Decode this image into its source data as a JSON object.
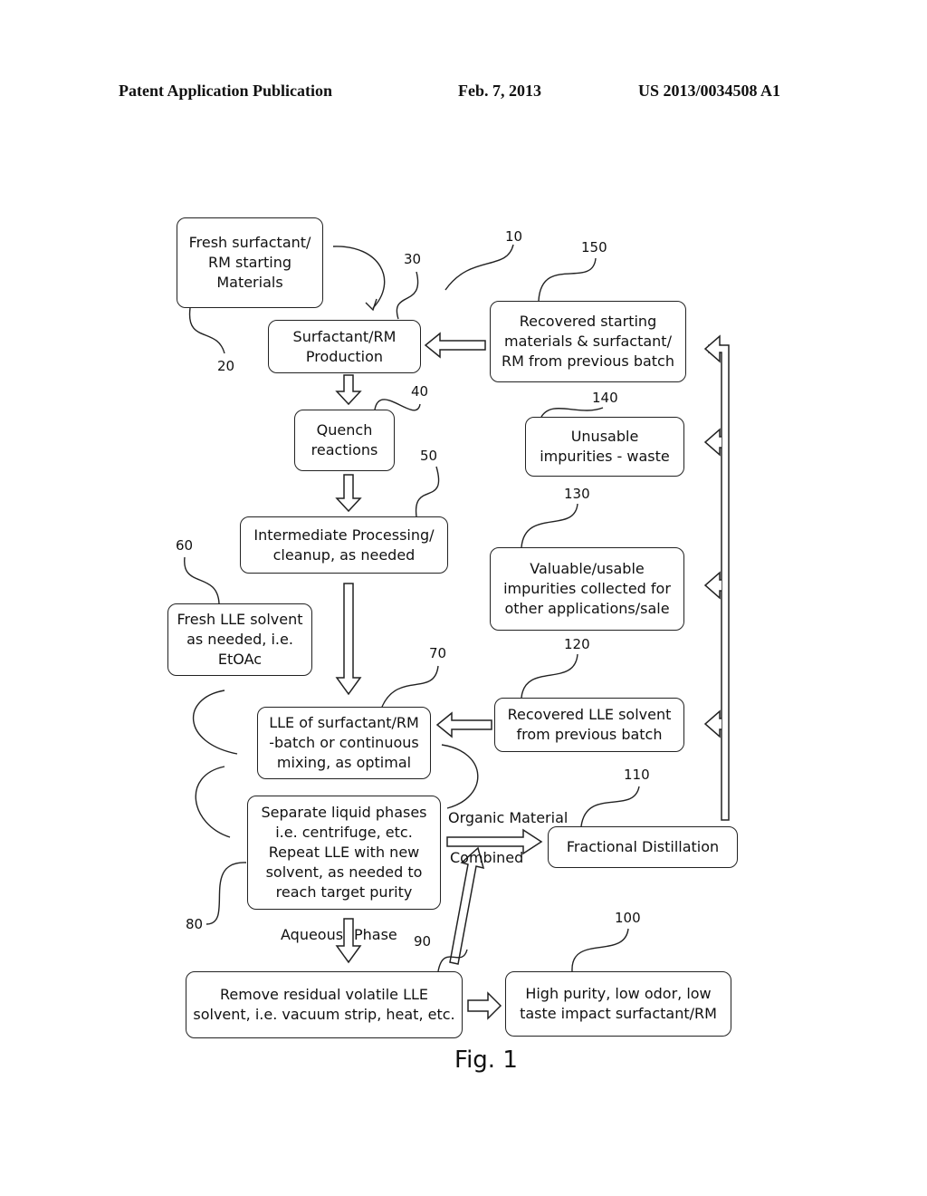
{
  "header": {
    "left": "Patent Application Publication",
    "center": "Feb. 7, 2013",
    "right": "US 2013/0034508 A1"
  },
  "boxes": {
    "fresh_surfactant": "Fresh surfactant/\nRM starting\nMaterials",
    "production": "Surfactant/RM\nProduction",
    "quench": "Quench\nreactions",
    "intermediate": "Intermediate Processing/\ncleanup, as needed",
    "fresh_lle": "Fresh LLE solvent\nas needed, i.e.\nEtOAc",
    "lle": "LLE of surfactant/RM\n-batch or continuous\nmixing, as optimal",
    "separate": "Separate liquid phases\ni.e. centrifuge, etc.\nRepeat LLE with new\nsolvent, as needed to\nreach target purity",
    "remove_residual": "Remove residual volatile LLE\nsolvent, i.e. vacuum strip, heat, etc.",
    "high_purity": "High purity, low odor, low\ntaste impact surfactant/RM",
    "fractional": "Fractional Distillation",
    "recovered_lle": "Recovered LLE solvent\nfrom previous batch",
    "valuable": "Valuable/usable\nimpurities collected for\nother applications/sale",
    "unusable": "Unusable\nimpurities - waste",
    "recovered_starting": "Recovered starting\nmaterials & surfactant/\nRM from previous batch"
  },
  "refs": {
    "r10": "10",
    "r20": "20",
    "r30": "30",
    "r40": "40",
    "r50": "50",
    "r60": "60",
    "r70": "70",
    "r80": "80",
    "r90": "90",
    "r100": "100",
    "r110": "110",
    "r120": "120",
    "r130": "130",
    "r140": "140",
    "r150": "150"
  },
  "labels": {
    "organic": "Organic Material",
    "combined": "Combined",
    "aqueous": "Aqueous",
    "phase": "Phase"
  },
  "figure": "Fig. 1"
}
